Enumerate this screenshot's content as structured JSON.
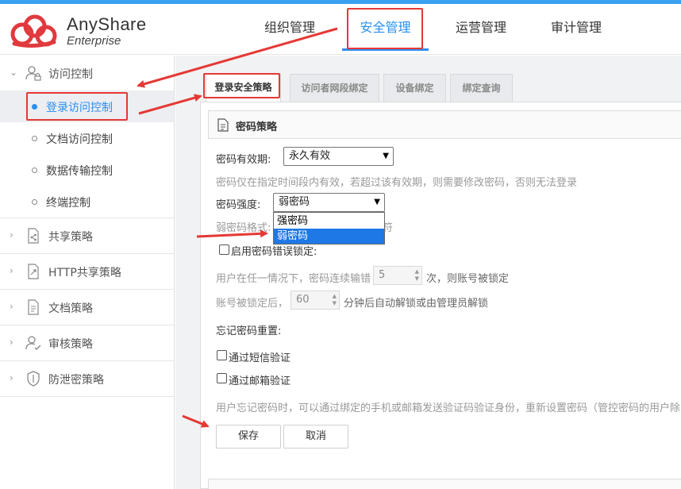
{
  "brand": {
    "name": "AnyShare",
    "subtitle": "Enterprise"
  },
  "nav": {
    "tabs": [
      {
        "label": "组织管理"
      },
      {
        "label": "安全管理"
      },
      {
        "label": "运营管理"
      },
      {
        "label": "审计管理"
      }
    ],
    "active": "安全管理"
  },
  "sidebar": {
    "access_control": {
      "label": "访问控制",
      "items": [
        {
          "label": "登录访问控制"
        },
        {
          "label": "文档访问控制"
        },
        {
          "label": "数据传输控制"
        },
        {
          "label": "终端控制"
        }
      ]
    },
    "groups": [
      {
        "label": "共享策略",
        "icon": "share-policy-icon"
      },
      {
        "label": "HTTP共享策略",
        "icon": "http-share-icon"
      },
      {
        "label": "文档策略",
        "icon": "document-policy-icon"
      },
      {
        "label": "审核策略",
        "icon": "audit-policy-icon"
      },
      {
        "label": "防泄密策略",
        "icon": "shield-icon"
      }
    ]
  },
  "subtabs": [
    {
      "label": "登录安全策略"
    },
    {
      "label": "访问者网段绑定"
    },
    {
      "label": "设备绑定"
    },
    {
      "label": "绑定查询"
    }
  ],
  "password_policy": {
    "section_title": "密码策略",
    "validity_label": "密码有效期:",
    "validity_value": "永久有效",
    "validity_hint": "密码仅在指定时间段内有效，若超过该有效期，则需要修改密码，否则无法登录",
    "strength_label": "密码强度:",
    "strength_value": "弱密码",
    "strength_options": [
      "强密码",
      "弱密码"
    ],
    "weak_format_label": "弱密码格式:",
    "weak_format_tail": "符",
    "lock_label": "启用密码错误锁定:",
    "lock_hint_prefix": "用户在任一情况下，密码连续输错",
    "lock_count": "5",
    "lock_hint_suffix": "次，则账号被锁定",
    "unlock_prefix": "账号被锁定后，",
    "unlock_minutes": "60",
    "unlock_suffix": "分钟后自动解锁或由管理员解锁",
    "reset_label": "忘记密码重置:",
    "reset_sms": "通过短信验证",
    "reset_email": "通过邮箱验证",
    "reset_hint": "用户忘记密码时，可以通过绑定的手机或邮箱发送验证码验证身份，重新设置密码（管控密码的用户除",
    "save_label": "保存",
    "cancel_label": "取消"
  },
  "colors": {
    "accent": "#2b8ff0",
    "annotation": "#e53935"
  }
}
